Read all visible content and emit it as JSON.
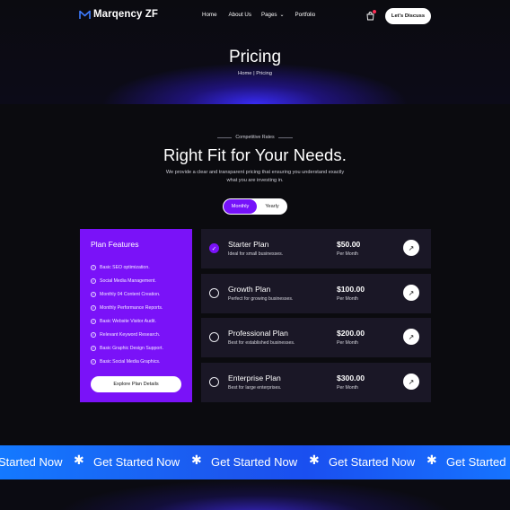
{
  "brand": {
    "name": "Marqency ZF",
    "accent": "#7a12f8",
    "marquee_blue": "#1c57ee"
  },
  "nav": {
    "items": [
      "Home",
      "About Us",
      "Pages",
      "Portfolio"
    ],
    "cta": "Let's Discuss",
    "icons": {
      "logo": "m-logo-icon",
      "cart": "bag-icon",
      "pages_dropdown": "chevron-down-icon"
    }
  },
  "hero": {
    "title": "Pricing",
    "breadcrumb": "Home | Pricing"
  },
  "section": {
    "eyebrow": "Competitive Rates",
    "title": "Right Fit for Your Needs.",
    "description": "We provide a clear and transparent pricing that ensuring you understand exactly what you are investing in."
  },
  "toggle": {
    "monthly": "Monthly",
    "yearly": "Yearly",
    "selected": "Monthly"
  },
  "features": {
    "title": "Plan Features",
    "items": [
      "Basic SEO optimization.",
      "Social Media Management.",
      "Monthly 04 Content Creation.",
      "Monthly Performance Reports.",
      "Basic Website Visitor Audit.",
      "Relevant Keyword Research.",
      "Basic Graphic Design Support.",
      "Basic Social Media Graphics."
    ],
    "button": "Explore Plan Details"
  },
  "plans": [
    {
      "name": "Starter Plan",
      "desc": "Ideal for small businesses.",
      "price": "$50.00",
      "period": "Per Month",
      "selected": true
    },
    {
      "name": "Growth Plan",
      "desc": "Perfect for growing businesses.",
      "price": "$100.00",
      "period": "Per Month",
      "selected": false
    },
    {
      "name": "Professional Plan",
      "desc": "Best for established businesses.",
      "price": "$200.00",
      "period": "Per Month",
      "selected": false
    },
    {
      "name": "Enterprise Plan",
      "desc": "Best for large enterprises.",
      "price": "$300.00",
      "period": "Per Month",
      "selected": false
    }
  ],
  "marquee": {
    "items": [
      "Started Now",
      "Get Started Now",
      "Get Started Now",
      "Get Started Now",
      "Get Started"
    ],
    "separator": "✱"
  }
}
